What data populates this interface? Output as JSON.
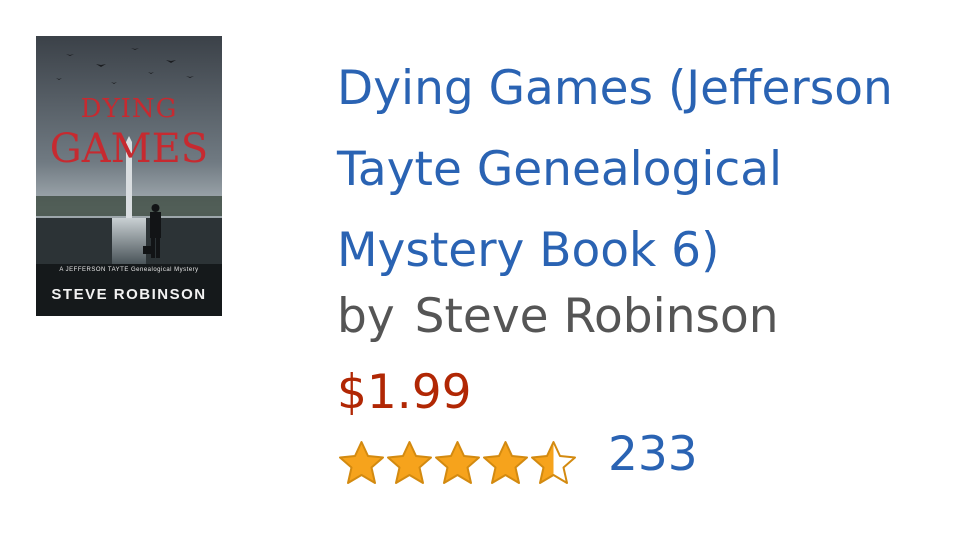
{
  "book": {
    "cover": {
      "title_line1": "DYING",
      "title_line2": "GAMES",
      "series_line": "A JEFFERSON TAYTE Genealogical Mystery",
      "author": "STEVE ROBINSON"
    },
    "title": "Dying Games (Jefferson Tayte Genealogical Mystery Book 6)",
    "by_label": "by",
    "author": "Steve Robinson",
    "price": "$1.99",
    "rating": {
      "stars_out_of_5": 4.5,
      "review_count": "233"
    }
  },
  "colors": {
    "title_link": "#2a63b3",
    "price": "#b12704",
    "star_fill": "#f6a31c",
    "star_outline": "#d38a10"
  }
}
